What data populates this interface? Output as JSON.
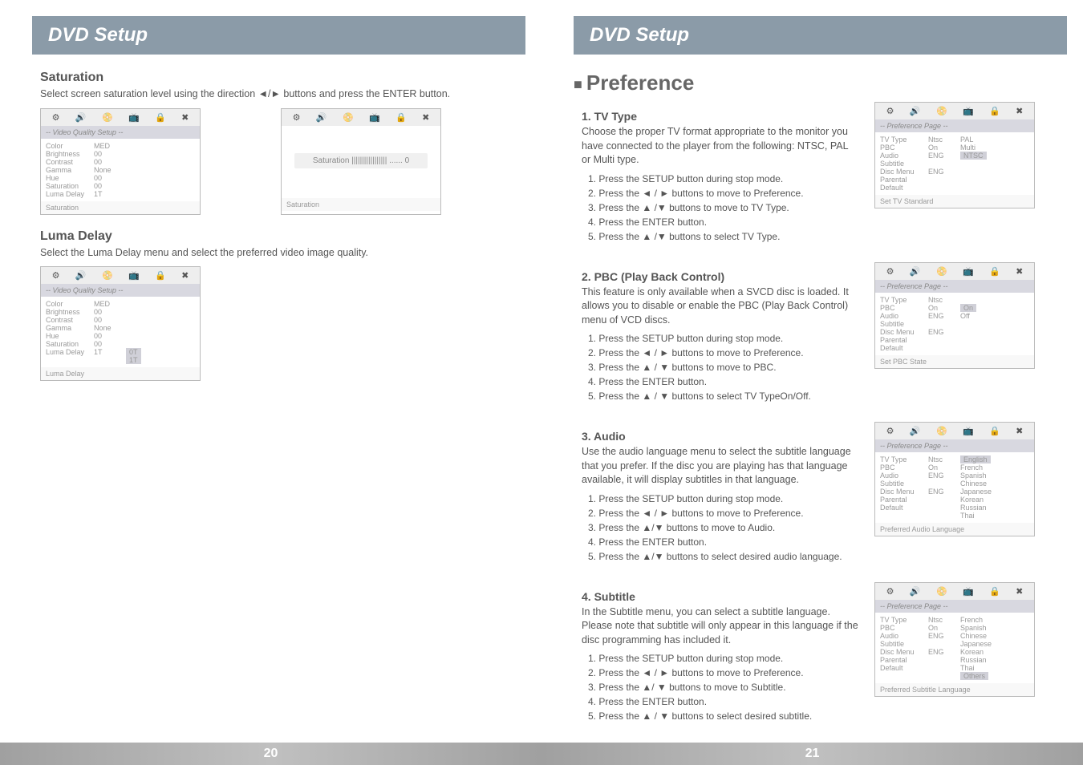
{
  "left_page": {
    "header": "DVD Setup",
    "page_number": "20",
    "saturation": {
      "title": "Saturation",
      "text": "Select screen saturation level using the direction ◄/► buttons and press the ENTER button.",
      "osd1": {
        "title": "-- Video Quality Setup --",
        "rows": [
          [
            "Color",
            "MED"
          ],
          [
            "Brightness",
            "00"
          ],
          [
            "Contrast",
            "00"
          ],
          [
            "Gamma",
            "None"
          ],
          [
            "Hue",
            "00"
          ],
          [
            "Saturation",
            "00"
          ],
          [
            "Luma Delay",
            "1T"
          ]
        ],
        "foot": "Saturation"
      },
      "osd2": {
        "bar": "Saturation ||||||||||||||||| ...... 0",
        "foot": "Saturation"
      }
    },
    "luma": {
      "title": "Luma Delay",
      "text": "Select the Luma Delay menu and select the preferred video image quality.",
      "osd": {
        "title": "-- Video Quality Setup --",
        "rows": [
          [
            "Color",
            "MED",
            ""
          ],
          [
            "Brightness",
            "00",
            ""
          ],
          [
            "Contrast",
            "00",
            ""
          ],
          [
            "Gamma",
            "None",
            ""
          ],
          [
            "Hue",
            "00",
            ""
          ],
          [
            "Saturation",
            "00",
            ""
          ],
          [
            "Luma Delay",
            "1T",
            "0T"
          ]
        ],
        "extra": "1T",
        "foot": "Luma Delay"
      }
    }
  },
  "right_page": {
    "header": "DVD Setup",
    "preference": "Preference",
    "page_number": "21",
    "tvtype": {
      "title": "1. TV Type",
      "text": "Choose the proper TV format appropriate to the monitor you have connected to the player from the following: NTSC, PAL or Multi type.",
      "steps": [
        "1. Press the SETUP button during stop mode.",
        "2. Press the ◄ / ► buttons to move to Preference.",
        "3. Press the ▲ /▼ buttons to move to TV Type.",
        "4. Press the ENTER button.",
        "5. Press the ▲ /▼ buttons to select TV Type."
      ],
      "osd": {
        "title": "-- Preference Page --",
        "rows": [
          [
            "TV Type",
            "Ntsc",
            "PAL"
          ],
          [
            "PBC",
            "On",
            "Multi"
          ],
          [
            "Audio",
            "ENG",
            "NTSC"
          ],
          [
            "Subtitle",
            "",
            ""
          ],
          [
            "Disc Menu",
            "ENG",
            ""
          ],
          [
            "Parental",
            "",
            ""
          ],
          [
            "Default",
            "",
            ""
          ]
        ],
        "foot": "Set TV Standard"
      }
    },
    "pbc": {
      "title": "2. PBC (Play Back Control)",
      "text": "This feature is only available when a SVCD disc is loaded. It allows you to disable or enable the PBC (Play Back Control) menu of VCD discs.",
      "steps": [
        "1. Press the SETUP button during stop mode.",
        "2. Press the ◄ / ► buttons to move to Preference.",
        "3. Press the ▲ / ▼ buttons to move to PBC.",
        "4. Press the ENTER button.",
        "5. Press the ▲ / ▼ buttons to select TV TypeOn/Off."
      ],
      "osd": {
        "title": "-- Preference Page --",
        "rows": [
          [
            "TV Type",
            "Ntsc",
            ""
          ],
          [
            "PBC",
            "On",
            "On"
          ],
          [
            "Audio",
            "ENG",
            "Off"
          ],
          [
            "Subtitle",
            "",
            ""
          ],
          [
            "Disc Menu",
            "ENG",
            ""
          ],
          [
            "Parental",
            "",
            ""
          ],
          [
            "Default",
            "",
            ""
          ]
        ],
        "foot": "Set PBC State"
      }
    },
    "audio": {
      "title": "3. Audio",
      "text": "Use the audio language menu to select the subtitle language that you prefer. If the disc you are playing has that language available, it will display subtitles in that language.",
      "steps": [
        "1. Press the SETUP button during stop mode.",
        "2. Press the ◄ / ► buttons to move to Preference.",
        "3. Press the ▲/▼ buttons to move to Audio.",
        "4. Press the ENTER button.",
        "5. Press the ▲/▼ buttons to select desired audio language."
      ],
      "osd": {
        "title": "-- Preference Page --",
        "rows": [
          [
            "TV Type",
            "Ntsc",
            "English"
          ],
          [
            "PBC",
            "On",
            "French"
          ],
          [
            "Audio",
            "ENG",
            "Spanish"
          ],
          [
            "Subtitle",
            "",
            "Chinese"
          ],
          [
            "Disc Menu",
            "ENG",
            "Japanese"
          ],
          [
            "Parental",
            "",
            "Korean"
          ],
          [
            "Default",
            "",
            "Russian"
          ],
          [
            "",
            "",
            "Thai"
          ]
        ],
        "foot": "Preferred Audio Language"
      }
    },
    "subtitle": {
      "title": "4. Subtitle",
      "text": "In the Subtitle menu, you can select a subtitle language. Please note that subtitle will only appear in this language if the disc programming has included it.",
      "steps": [
        "1. Press the SETUP button during stop mode.",
        "2. Press the ◄ / ► buttons to move to Preference.",
        "3. Press the ▲/ ▼ buttons to move to Subtitle.",
        "4. Press the ENTER button.",
        "5. Press the ▲ / ▼ buttons to select desired subtitle."
      ],
      "osd": {
        "title": "-- Preference Page --",
        "rows": [
          [
            "TV Type",
            "Ntsc",
            "French"
          ],
          [
            "PBC",
            "On",
            "Spanish"
          ],
          [
            "Audio",
            "ENG",
            "Chinese"
          ],
          [
            "Subtitle",
            "",
            "Japanese"
          ],
          [
            "Disc Menu",
            "ENG",
            "Korean"
          ],
          [
            "Parental",
            "",
            "Russian"
          ],
          [
            "Default",
            "",
            "Thai"
          ],
          [
            "",
            "",
            "Others"
          ]
        ],
        "foot": "Preferred Subtitle Language"
      }
    }
  }
}
